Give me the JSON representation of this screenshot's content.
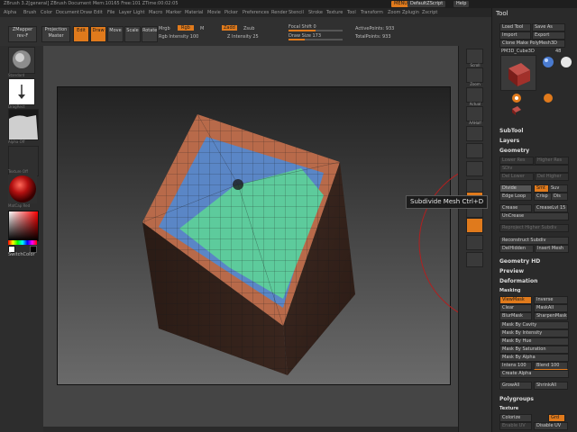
{
  "titlebar": {
    "title": "ZBrush 3.2[general]  ZBrush Document   Mem:10165 Free:101 ZTime:00:02:05",
    "menu_btn": "MENU",
    "default_script": "DefaultZScript",
    "help": "Help"
  },
  "menubar": [
    "Alpha",
    "Brush",
    "Color",
    "Document",
    "Draw",
    "Edit",
    "File",
    "Layer",
    "Light",
    "Macro",
    "Marker",
    "Material",
    "Movie",
    "Picker",
    "Preferences",
    "Render",
    "Stencil",
    "Stroke",
    "Texture",
    "Tool",
    "Transform",
    "Zoom",
    "Zplugin",
    "Zscript"
  ],
  "shelf": {
    "zmapper": "ZMapper",
    "zmapper_sub": "rev-F",
    "projection": "Projection",
    "projection_sub": "Master",
    "edit": "Edit",
    "draw": "Draw",
    "move": "Move",
    "scale": "Scale",
    "rotate": "Rotate",
    "mrgb": "Mrgb",
    "rgb": "Rgb",
    "m": "M",
    "rgb_intensity": "Rgb Intensity 100",
    "zadd": "Zadd",
    "zsub": "Zsub",
    "z_intensity": "Z Intensity 25",
    "focal_shift": "Focal Shift 0",
    "draw_size": "Draw Size 173",
    "active_points": "ActivePoints: 933",
    "total_points": "TotalPoints: 933"
  },
  "lefttray": {
    "brush_label": "Standard",
    "stroke_label": "DragRect",
    "alpha_label": "Alpha Off",
    "texture_label": "Texture Off",
    "material_label": "MatCap Red",
    "switch_color": "SwitchColor"
  },
  "rshelf": [
    "Scroll",
    "Zoom",
    "Actual",
    "AAHalf",
    "Persp",
    "Floor",
    "Local",
    "L.Sym",
    "Xyz",
    "Frame",
    "Move",
    "Scale",
    "Rotate",
    "PolyF",
    "Transp",
    "Ghost"
  ],
  "tooltip": {
    "text": "Subdivide Mesh",
    "shortcut": "Ctrl+D"
  },
  "panel": {
    "header": "Tool",
    "load_tool": "Load Tool",
    "save_as": "Save As",
    "import": "Import",
    "export": "Export",
    "clone": "Clone",
    "make_polymesh": "Make PolyMesh3D",
    "current_tool": "PM3D_Cube3D",
    "current_tool_num": "48",
    "thumbs": [
      "PM3D_Cube3D",
      "Sphere3D",
      "ZSphere",
      "PM3D_Cube3D_1"
    ],
    "subtool": "SubTool",
    "layers": "Layers",
    "geometry": "Geometry",
    "lower_res": "Lower Res",
    "higher_res": "Higher Res",
    "sdiv": "SDiv",
    "del_lower": "Del Lower",
    "del_higher": "Del Higher",
    "divide": "Divide",
    "smt": "Smt",
    "suv": "Suv",
    "edge_loop": "Edge Loop",
    "crisp": "Crisp",
    "dis": "Dis",
    "crease": "Crease",
    "crease_lvl": "CreaseLvl 15",
    "uncrease": "UnCrease",
    "reproject": "Reproject Higher Subdiv",
    "reconstruct": "Reconstruct Subdiv",
    "delhidden": "DelHidden",
    "insert_mesh": "Insert Mesh",
    "geometry_hd": "Geometry HD",
    "preview": "Preview",
    "deformation": "Deformation",
    "masking": "Masking",
    "viewmask": "ViewMask",
    "inverse": "Inverse",
    "clear": "Clear",
    "maskall": "MaskAll",
    "blurmask": "BlurMask",
    "sharpenmask": "SharpenMask",
    "mask_cavity": "Mask By Cavity",
    "mask_intensity": "Mask By Intensity",
    "mask_hue": "Mask By Hue",
    "mask_saturation": "Mask By Saturation",
    "mask_alpha": "Mask By Alpha",
    "intensity": "Intens 100",
    "blend": "Blend 100",
    "create_alpha": "Create Alpha",
    "grow": "GrowAll",
    "shrink": "ShrinkAll",
    "polygroups": "Polygroups",
    "texture": "Texture",
    "colorize": "Colorize",
    "grd": "Grd",
    "txtr_on": "Enable UV",
    "disable_uv": "Disable UV"
  },
  "colors": {
    "accent": "#e07a1c",
    "cube_top_orange": "#c0704e",
    "cube_green": "#5ecb9c",
    "cube_blue": "#5b84c4"
  }
}
